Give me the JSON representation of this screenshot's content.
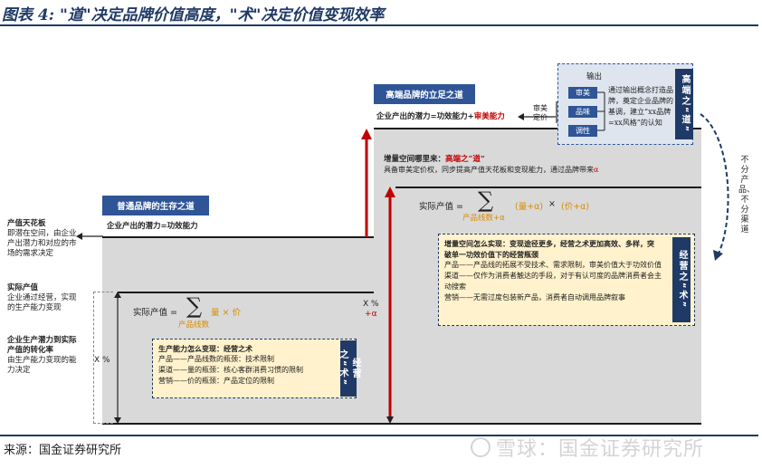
{
  "title": "图表 4: \"道\"决定品牌价值高度，\"术\"决定价值变现效率",
  "source": "来源：国金证券研究所",
  "watermark": "雪球：国金证券研究所",
  "left_notes": {
    "ceiling_head": "产值天花板",
    "ceiling_body": "即潜在空间，由企业产出潜力和对应的市场的需求决定",
    "actual_head": "实际产值",
    "actual_body": "企业通过经营，实现的生产能力变现",
    "rate_head": "企业生产潜力到实际产值的转化率",
    "rate_body": "由生产能力变现的能力决定"
  },
  "left_panel": {
    "title": "普通品牌的生存之道",
    "potential": "企业产出的潜力=功效能力",
    "formula_label": "实际产值 =",
    "sum_symbol": "∑",
    "term": "量 × 价",
    "sub": "产品线数",
    "x_label": "X %",
    "box_head": "生产能力怎么变现：经营之术",
    "box_lines": [
      "产品——产品线数的瓶颈：技术限制",
      "渠道——量的瓶颈：核心客群消费习惯的限制",
      "营销——价的瓶颈：产品定位的限制"
    ],
    "badge": "经营之“术”"
  },
  "right_panel": {
    "title": "高端品牌的立足之道",
    "potential_a": "企业产出的潜力=功效能力+",
    "potential_b": "审美能力",
    "aesthetic_pricing": "审美\n定价",
    "growth_head_a": "增量空间哪里来：",
    "growth_head_b": "高端之“道”",
    "growth_body_a": "具备审美定价权，同步提高产值天花板和变现能力，通过品牌带来",
    "growth_body_b": "α",
    "formula_label": "实际产值 =",
    "sum_symbol": "∑",
    "term_a": "(量+α)",
    "times": "×",
    "term_b": "(价+α)",
    "sub": "产品线数+α",
    "x_label_a": "X %",
    "x_label_b": "+α",
    "box_head": "增量空间怎么实现：变现途径更多，经营之术更加高效、多样，突破单一功效价值下的经营瓶颈",
    "box_lines": [
      "产品——产品线的拓展不受技术、需求限制，审美价值大于功效价值",
      "渠道——仅作为消费者触达的手段，对于有认可度的品牌消费者会主动搜索",
      "营销——无需过度包装新产品，消费者自动调用品牌叙事"
    ],
    "badge": "经营之“术”"
  },
  "output_box": {
    "title": "输出",
    "buttons": [
      "审美",
      "品味",
      "调性"
    ],
    "text": "通过输出概念打造品牌，奠定企业品牌的基调，建立“xx品牌=xx风格”的认知",
    "badge": "高端之“道”"
  },
  "right_side": "不分产品、不分渠道"
}
